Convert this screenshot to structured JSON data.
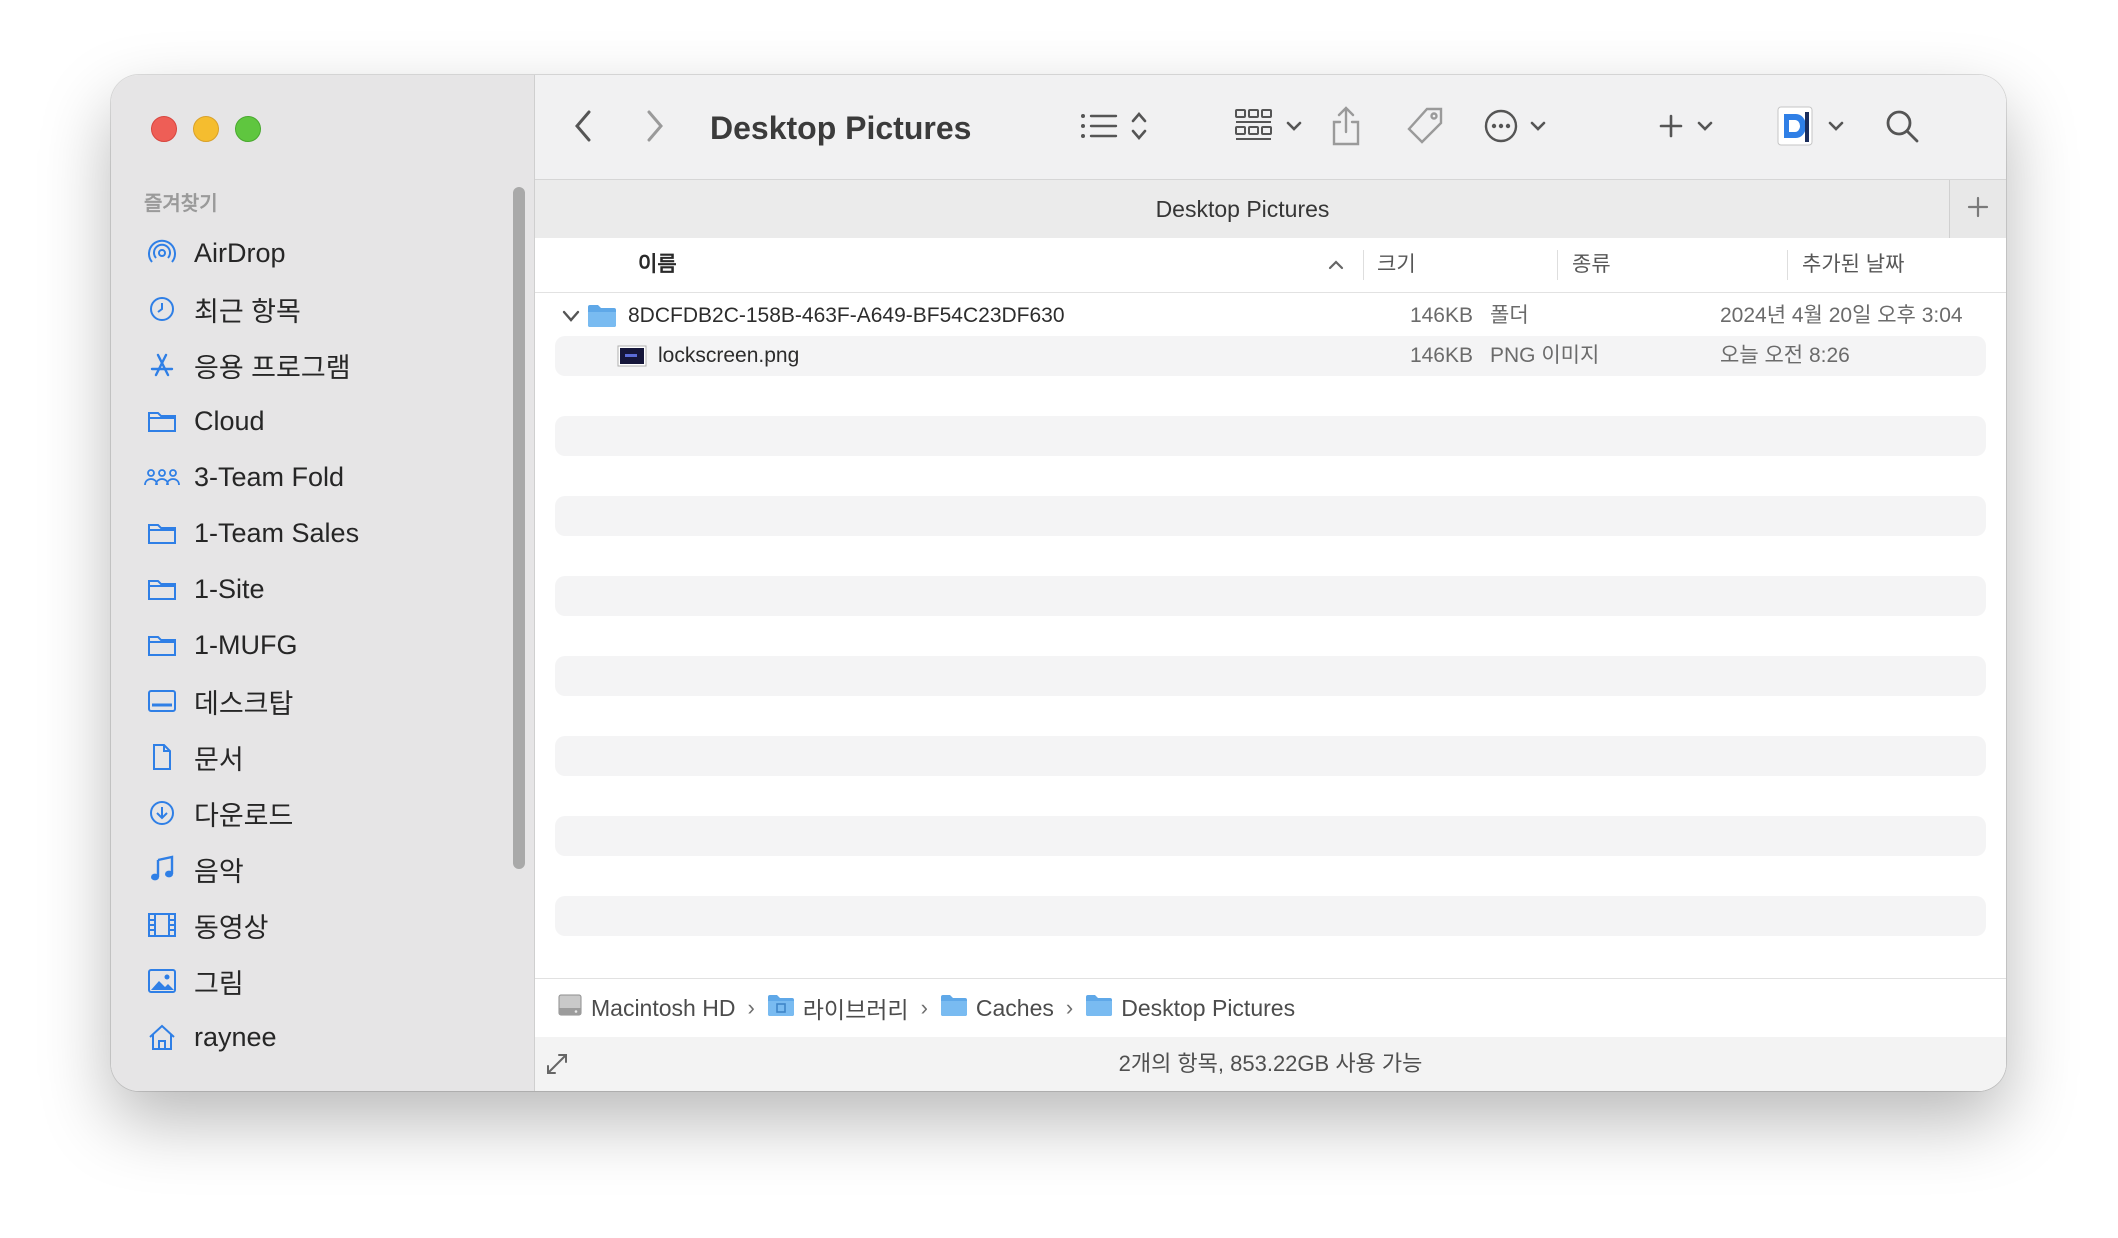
{
  "window": {
    "title": "Desktop Pictures",
    "tab_title": "Desktop Pictures"
  },
  "sidebar": {
    "heading": "즐겨찾기",
    "items": [
      {
        "label": "AirDrop",
        "icon": "airdrop-icon"
      },
      {
        "label": "최근 항목",
        "icon": "clock-icon"
      },
      {
        "label": "응용 프로그램",
        "icon": "applications-icon"
      },
      {
        "label": "Cloud",
        "icon": "folder-icon"
      },
      {
        "label": "3-Team Fold",
        "icon": "group-folder-icon"
      },
      {
        "label": "1-Team Sales",
        "icon": "folder-icon"
      },
      {
        "label": "1-Site",
        "icon": "folder-icon"
      },
      {
        "label": "1-MUFG",
        "icon": "folder-icon"
      },
      {
        "label": "데스크탑",
        "icon": "desktop-icon"
      },
      {
        "label": "문서",
        "icon": "document-icon"
      },
      {
        "label": "다운로드",
        "icon": "download-icon"
      },
      {
        "label": "음악",
        "icon": "music-icon"
      },
      {
        "label": "동영상",
        "icon": "film-icon"
      },
      {
        "label": "그림",
        "icon": "photo-icon"
      },
      {
        "label": "raynee",
        "icon": "home-icon"
      }
    ]
  },
  "columns": {
    "name": "이름",
    "size": "크기",
    "kind": "종류",
    "date_added": "추가된 날짜"
  },
  "files": [
    {
      "name": "8DCFDB2C-158B-463F-A649-BF54C23DF630",
      "size": "146KB",
      "kind": "폴더",
      "date_added": "2024년 4월 20일 오후 3:04",
      "icon": "folder-icon",
      "expanded": true
    },
    {
      "name": "lockscreen.png",
      "size": "146KB",
      "kind": "PNG 이미지",
      "date_added": "오늘 오전 8:26",
      "icon": "image-file-icon"
    }
  ],
  "path": [
    "Macintosh HD",
    "라이브러리",
    "Caches",
    "Desktop Pictures"
  ],
  "status": "2개의 항목, 853.22GB 사용 가능",
  "colors": {
    "accent": "#2f7fe6",
    "folder": "#6eb4ee",
    "sidebar_bg": "#e6e5e6"
  }
}
